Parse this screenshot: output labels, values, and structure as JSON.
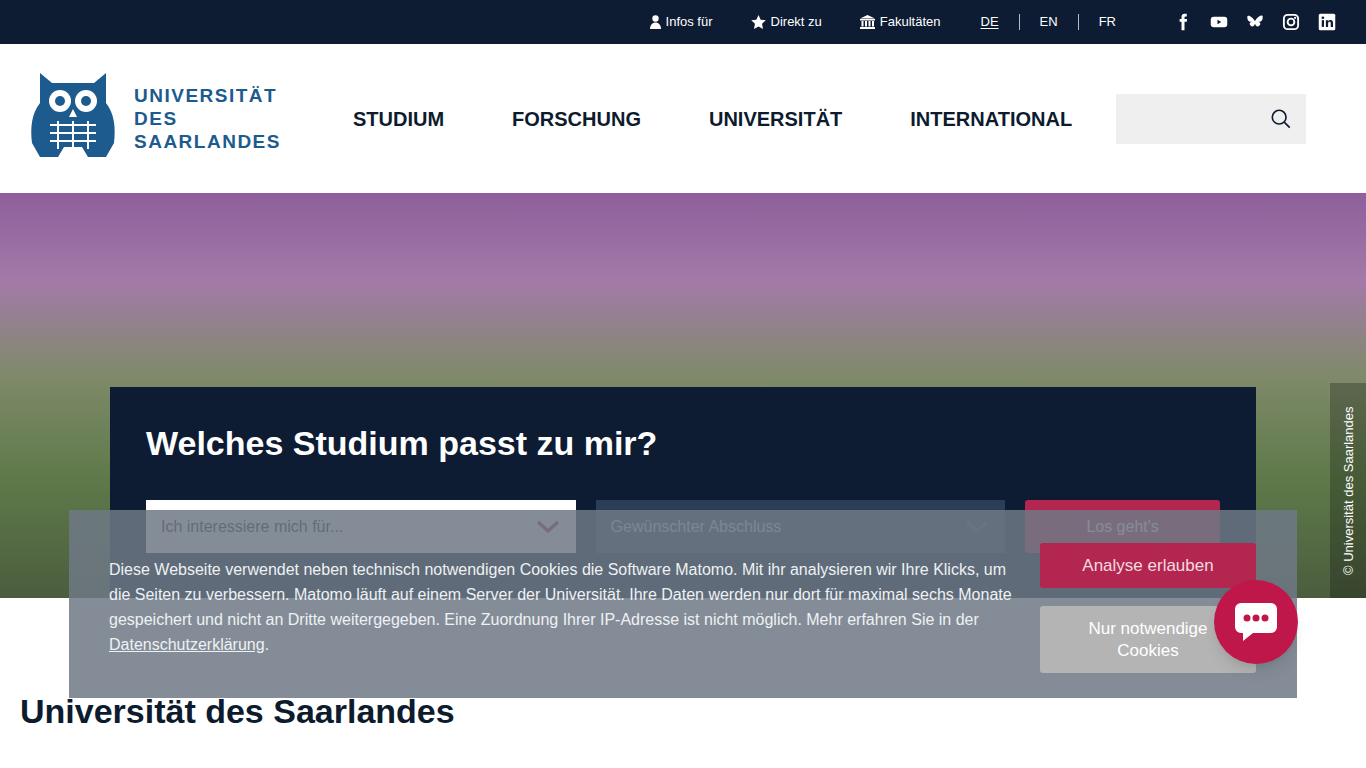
{
  "topbar": {
    "links": [
      "Infos für",
      "Direkt zu",
      "Fakultäten"
    ],
    "languages": [
      {
        "label": "DE",
        "selected": true
      },
      {
        "label": "EN",
        "selected": false
      },
      {
        "label": "FR",
        "selected": false
      }
    ]
  },
  "logo": {
    "lines": [
      "UNIVERSITÄT",
      "DES",
      "SAARLANDES"
    ]
  },
  "nav": [
    "STUDIUM",
    "FORSCHUNG",
    "UNIVERSITÄT",
    "INTERNATIONAL"
  ],
  "hero": {
    "credit": "© Universität des Saarlandes",
    "finder": {
      "title": "Welches Studium passt zu mir?",
      "interest": "Ich interessiere mich für...",
      "degree": "Gewünschter Abschluss",
      "submit": "Los geht's"
    }
  },
  "cookie_banner": {
    "text": "Diese Webseite verwendet neben technisch notwendigen Cookies die Software Matomo. Mit ihr analysieren wir Ihre Klicks, um die Seiten zu verbessern. Matomo läuft auf einem Server der Universität. Ihre Daten werden nur dort für maximal sechs Monate gespeichert und nicht an Dritte weitergegeben. Eine Zuordnung Ihrer IP-Adresse ist nicht möglich. Mehr erfahren Sie in der ",
    "link": "Datenschutzerklärung",
    "after": ".",
    "buttons": [
      "Analyse erlauben",
      "Nur notwendige Cookies"
    ]
  },
  "page": {
    "heading": "Universität des Saarlandes"
  }
}
